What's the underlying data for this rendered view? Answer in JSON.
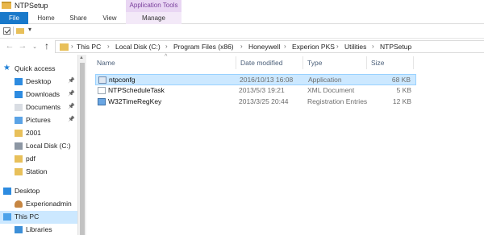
{
  "window": {
    "title": "NTPSetup",
    "context_tab": "Application Tools"
  },
  "ribbon": {
    "tabs": [
      {
        "label": "File"
      },
      {
        "label": "Home"
      },
      {
        "label": "Share"
      },
      {
        "label": "View"
      },
      {
        "label": "Manage"
      }
    ]
  },
  "address": {
    "crumbs": [
      "This PC",
      "Local Disk (C:)",
      "Program Files (x86)",
      "Honeywell",
      "Experion PKS",
      "Utilities",
      "NTPSetup"
    ],
    "separator": "›"
  },
  "nav": {
    "back": "←",
    "forward": "→",
    "recent": "⌄",
    "up": "↑"
  },
  "sidebar": {
    "items": [
      {
        "label": "Quick access",
        "icon": "star-icon",
        "pinned": false
      },
      {
        "label": "Desktop",
        "icon": "desktop-icon",
        "pinned": true
      },
      {
        "label": "Downloads",
        "icon": "downloads-icon",
        "pinned": true
      },
      {
        "label": "Documents",
        "icon": "documents-icon",
        "pinned": true
      },
      {
        "label": "Pictures",
        "icon": "pictures-icon",
        "pinned": true
      },
      {
        "label": "2001",
        "icon": "folder-icon",
        "pinned": false
      },
      {
        "label": "Local Disk (C:)",
        "icon": "drive-icon",
        "pinned": false
      },
      {
        "label": "pdf",
        "icon": "folder-icon",
        "pinned": false
      },
      {
        "label": "Station",
        "icon": "folder-icon",
        "pinned": false
      },
      {
        "label": "Desktop",
        "icon": "desktop-icon",
        "pinned": false
      },
      {
        "label": "Experionadmin",
        "icon": "user-icon",
        "pinned": false
      },
      {
        "label": "This PC",
        "icon": "computer-icon",
        "pinned": false,
        "selected": true
      },
      {
        "label": "Libraries",
        "icon": "libraries-icon",
        "pinned": false
      }
    ],
    "pin_glyph": "📌"
  },
  "columns": {
    "name": "Name",
    "date": "Date modified",
    "type": "Type",
    "size": "Size",
    "sort_caret": "^"
  },
  "files": [
    {
      "name": "ntpconfg",
      "date": "2016/10/13 16:08",
      "type": "Application",
      "size": "68 KB",
      "icon": "application-icon",
      "selected": true
    },
    {
      "name": "NTPScheduleTask",
      "date": "2013/5/3 19:21",
      "type": "XML Document",
      "size": "5 KB",
      "icon": "xml-document-icon",
      "selected": false
    },
    {
      "name": "W32TimeRegKey",
      "date": "2013/3/25 20:44",
      "type": "Registration Entries",
      "size": "12 KB",
      "icon": "registry-icon",
      "selected": false
    }
  ],
  "colors": {
    "file_tab": "#1979ca",
    "selection": "#cce8ff",
    "context_tab": "#e9d6f3",
    "folder": "#e8c05a"
  }
}
